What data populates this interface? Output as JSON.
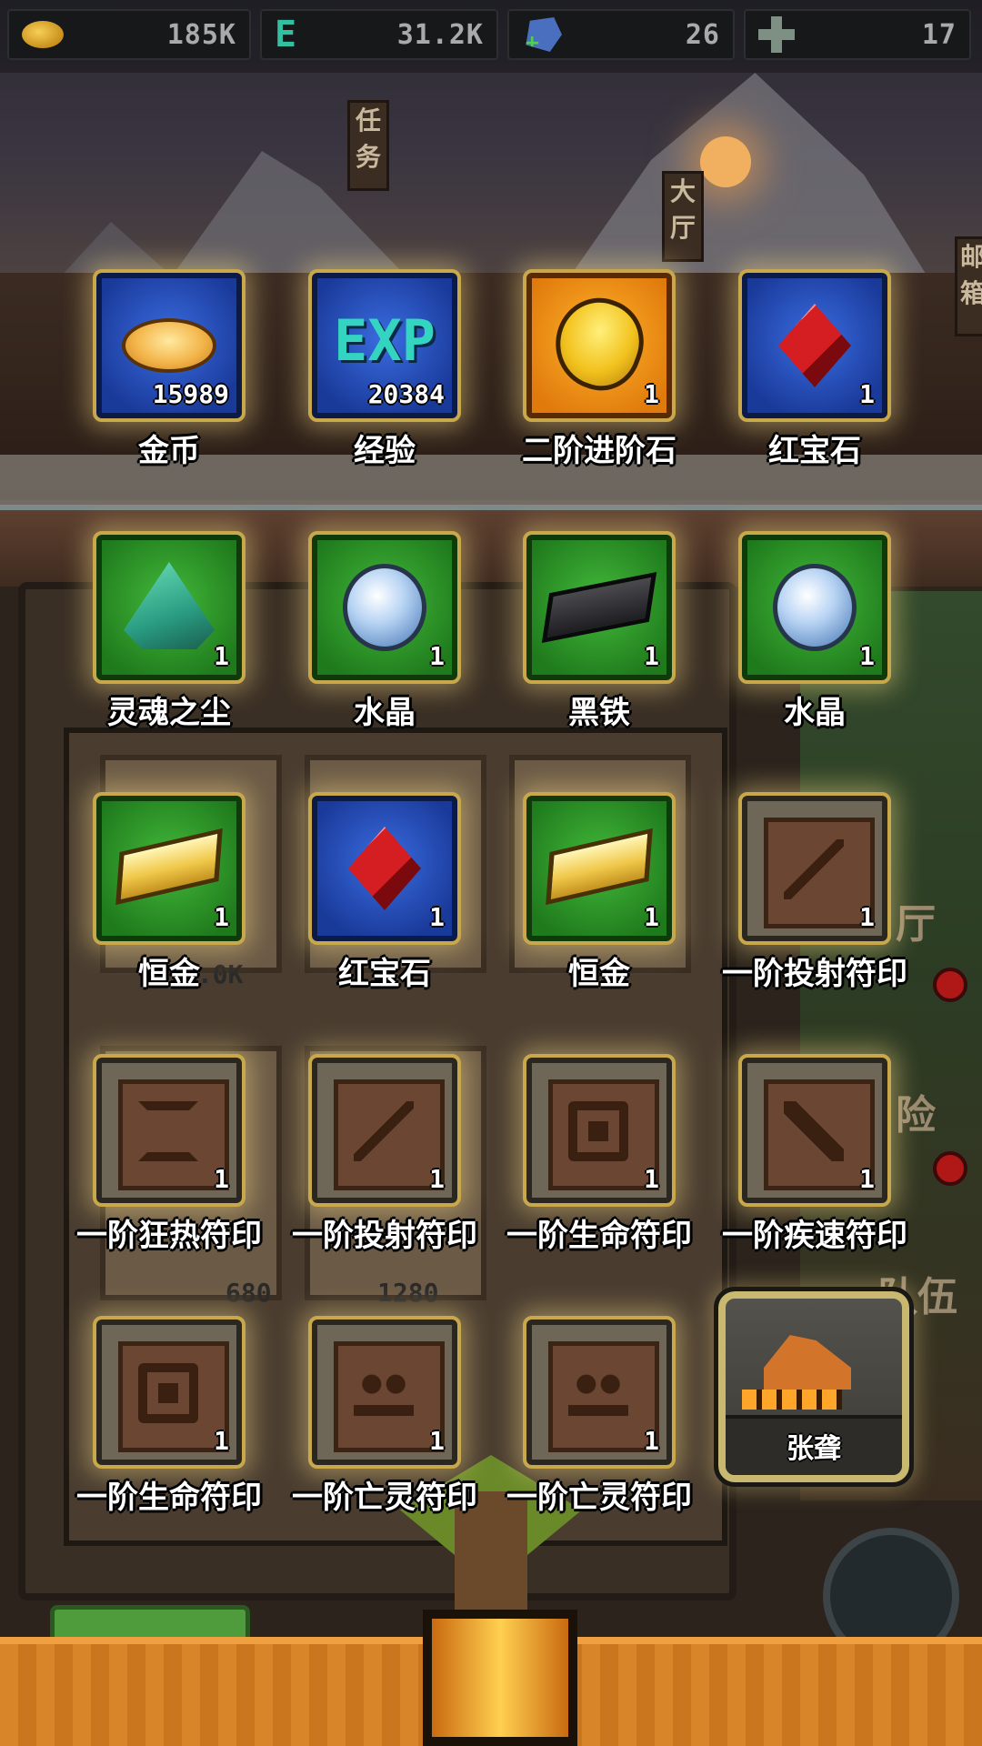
{
  "resources": [
    {
      "icon": "gold-coin-icon",
      "value": "185K"
    },
    {
      "icon": "exp-icon",
      "value": "31.2K"
    },
    {
      "icon": "gem-plus-icon",
      "value": "26"
    },
    {
      "icon": "cross-icon",
      "value": "17"
    }
  ],
  "background": {
    "signs": [
      "任务",
      "大厅",
      "邮箱"
    ],
    "side_labels": [
      "厅",
      "险",
      "队伍"
    ],
    "shop_prices": [
      "0.0K",
      "680",
      "1280"
    ]
  },
  "rewards": [
    {
      "name": "金币",
      "count": "15989",
      "tier": "blue",
      "art": "coin"
    },
    {
      "name": "经验",
      "count": "20384",
      "tier": "blue",
      "art": "exp",
      "art_text": "EXP"
    },
    {
      "name": "二阶进阶石",
      "count": "1",
      "tier": "orange",
      "art": "gold-stone"
    },
    {
      "name": "红宝石",
      "count": "1",
      "tier": "blue",
      "art": "ruby"
    },
    {
      "name": "灵魂之尘",
      "count": "1",
      "tier": "green",
      "art": "soul-dust"
    },
    {
      "name": "水晶",
      "count": "1",
      "tier": "green",
      "art": "crystal"
    },
    {
      "name": "黑铁",
      "count": "1",
      "tier": "green",
      "art": "black-iron"
    },
    {
      "name": "水晶",
      "count": "1",
      "tier": "green",
      "art": "crystal"
    },
    {
      "name": "恒金",
      "count": "1",
      "tier": "green",
      "art": "gold-bar"
    },
    {
      "name": "红宝石",
      "count": "1",
      "tier": "blue",
      "art": "ruby"
    },
    {
      "name": "恒金",
      "count": "1",
      "tier": "green",
      "art": "gold-bar"
    },
    {
      "name": "一阶投射符印",
      "count": "1",
      "tier": "brown",
      "art": "rune-shoot"
    },
    {
      "name": "一阶狂热符印",
      "count": "1",
      "tier": "brown",
      "art": "rune-frenzy"
    },
    {
      "name": "一阶投射符印",
      "count": "1",
      "tier": "brown",
      "art": "rune-shoot"
    },
    {
      "name": "一阶生命符印",
      "count": "1",
      "tier": "brown",
      "art": "rune-life"
    },
    {
      "name": "一阶疾速符印",
      "count": "1",
      "tier": "brown",
      "art": "rune-haste"
    },
    {
      "name": "一阶生命符印",
      "count": "1",
      "tier": "brown",
      "art": "rune-life"
    },
    {
      "name": "一阶亡灵符印",
      "count": "1",
      "tier": "brown",
      "art": "rune-undead"
    },
    {
      "name": "一阶亡灵符印",
      "count": "1",
      "tier": "brown",
      "art": "rune-undead"
    }
  ],
  "hero": {
    "name": "张聋",
    "icon": "hero-sprite-icon"
  },
  "colors": {
    "gold_glow": "#ffe28c",
    "tier_blue": "#2a54c8",
    "tier_green": "#2f9c2a",
    "tier_orange": "#f0961a",
    "tier_brown": "#6b4632"
  }
}
